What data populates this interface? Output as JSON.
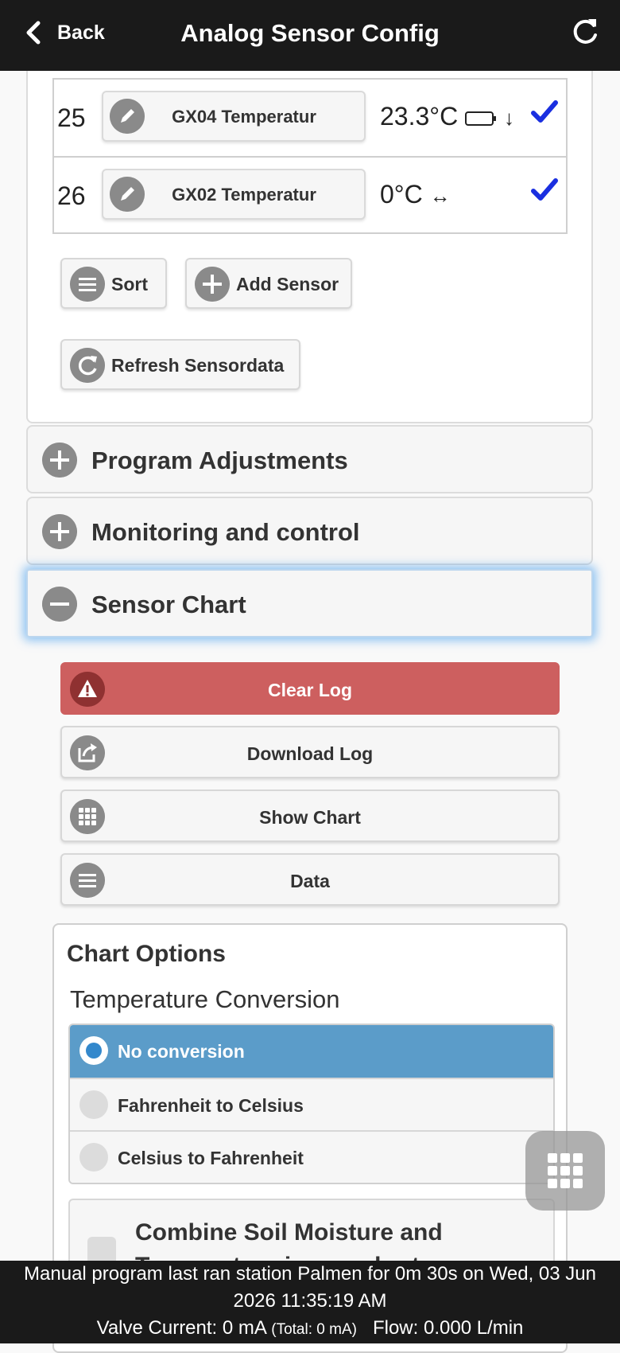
{
  "header": {
    "back_label": "Back",
    "title": "Analog Sensor Config"
  },
  "sensors": [
    {
      "nr": "25",
      "name": "GX04 Temperatur",
      "value": "23.3°C",
      "trend": "↓",
      "battery": true
    },
    {
      "nr": "26",
      "name": "GX02 Temperatur",
      "value": "0°C",
      "trend": "↔",
      "battery": false
    }
  ],
  "sensor_buttons": {
    "sort_label": "Sort",
    "add_label": "Add Sensor",
    "refresh_label": "Refresh Sensordata"
  },
  "sections": {
    "program_adjustments": "Program Adjustments",
    "monitoring": "Monitoring and control",
    "sensor_chart": "Sensor Chart"
  },
  "chart_actions": {
    "clear_log": "Clear Log",
    "download_log": "Download Log",
    "show_chart": "Show Chart",
    "data": "Data"
  },
  "chart_options": {
    "title": "Chart Options",
    "temperature_conversion": "Temperature Conversion",
    "options": [
      "No conversion",
      "Fahrenheit to Celsius",
      "Celsius to Fahrenheit"
    ],
    "selected": "No conversion",
    "combine_label": "Combine Soil Moisture and Temperature in one chart"
  },
  "footer": {
    "status": "Manual program last ran station Palmen for 0m 30s on Wed, 03 Jun 2026 11:35:19 AM",
    "valve_label": "Valve Current: 0 mA",
    "total_label": "(Total: 0 mA)",
    "flow_label": "Flow: 0.000 L/min"
  },
  "colors": {
    "header_bg": "#1a1a1a",
    "danger": "#cd5f5f",
    "selected_radio": "#5b9cc9",
    "check": "#1a2fe0",
    "focus_glow": "#3898ec"
  }
}
